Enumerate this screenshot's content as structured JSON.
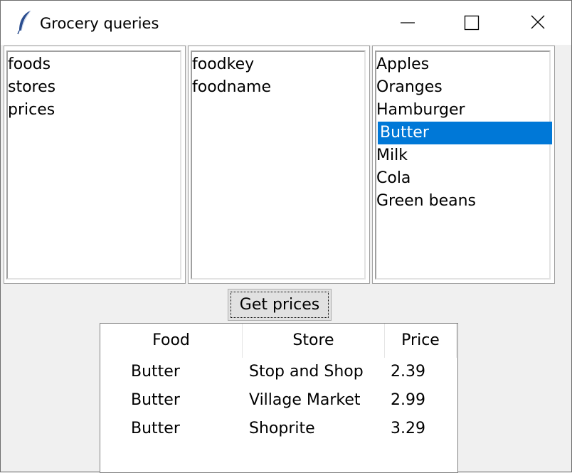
{
  "window": {
    "title": "Grocery queries",
    "icon": "feather-icon",
    "controls": [
      "minimize-icon",
      "maximize-icon",
      "close-icon"
    ]
  },
  "tables_list": {
    "items": [
      "foods",
      "stores",
      "prices"
    ]
  },
  "columns_list": {
    "items": [
      "foodkey",
      "foodname"
    ]
  },
  "foods_list": {
    "items": [
      "Apples",
      "Oranges",
      "Hamburger",
      "Butter",
      "Milk",
      "Cola",
      "Green beans"
    ],
    "selected": "Butter",
    "selection_color": "#0078d7"
  },
  "actions": {
    "get_prices_label": "Get prices"
  },
  "results": {
    "headers": [
      "Food",
      "Store",
      "Price"
    ],
    "rows": [
      [
        "Butter",
        "Stop and Shop",
        "2.39"
      ],
      [
        "Butter",
        "Village Market",
        "2.99"
      ],
      [
        "Butter",
        "Shoprite",
        "3.29"
      ]
    ]
  }
}
